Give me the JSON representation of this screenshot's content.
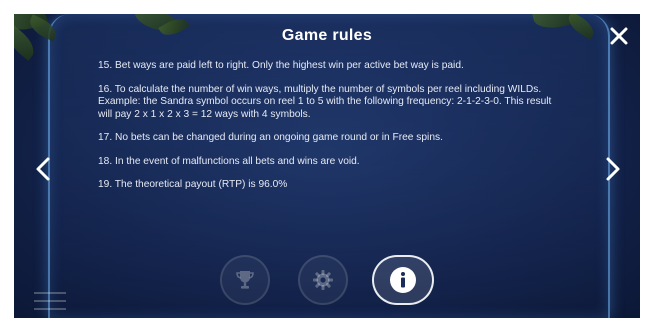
{
  "dialog": {
    "title": "Game rules"
  },
  "rules": [
    "15. Bet ways are paid left to right. Only the highest win per active bet way is paid.",
    "16. To calculate the number of win ways, multiply the number of symbols per reel including WILDs. Example: the Sandra symbol occurs on reel 1 to 5 with the following frequency:  2-1-2-3-0. This result will pay 2 x 1 x 2 x 3 = 12 ways with 4 symbols.",
    "17. No bets can be changed during an ongoing game round or in Free spins.",
    "18. In the event of malfunctions all bets and wins are void.",
    "19. The theoretical payout (RTP) is 96.0%"
  ],
  "icons": {
    "close": "close-icon",
    "prev": "chevron-left-icon",
    "next": "chevron-right-icon",
    "tabs": [
      "trophy-icon",
      "gear-icon",
      "info-icon"
    ],
    "menu": "hamburger-menu-icon"
  },
  "tabs": {
    "active": "info-icon"
  },
  "colors": {
    "background": "#13224a",
    "text": "#e6eaf4",
    "title": "#ffffff",
    "glow": "#78beff"
  }
}
